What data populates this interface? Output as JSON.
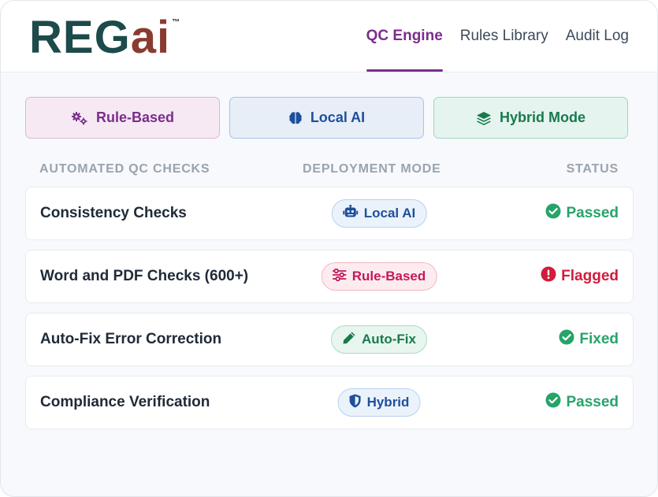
{
  "brand": {
    "logo_main": "REG",
    "logo_accent": "ai",
    "trademark": "™"
  },
  "nav": {
    "items": [
      {
        "label": "QC Engine",
        "active": true
      },
      {
        "label": "Rules Library",
        "active": false
      },
      {
        "label": "Audit Log",
        "active": false
      }
    ]
  },
  "modes": [
    {
      "label": "Rule-Based",
      "icon": "gears-icon"
    },
    {
      "label": "Local AI",
      "icon": "brain-icon"
    },
    {
      "label": "Hybrid Mode",
      "icon": "layers-icon"
    }
  ],
  "table": {
    "headers": {
      "check": "AUTOMATED QC CHECKS",
      "mode": "DEPLOYMENT MODE",
      "status": "STATUS"
    },
    "rows": [
      {
        "name": "Consistency Checks",
        "mode": "Local AI",
        "mode_icon": "robot-icon",
        "status": "Passed",
        "status_icon": "check-circle-icon"
      },
      {
        "name": "Word and PDF Checks (600+)",
        "mode": "Rule-Based",
        "mode_icon": "sliders-icon",
        "status": "Flagged",
        "status_icon": "exclamation-circle-icon"
      },
      {
        "name": "Auto-Fix Error Correction",
        "mode": "Auto-Fix",
        "mode_icon": "pencil-icon",
        "status": "Fixed",
        "status_icon": "check-circle-icon"
      },
      {
        "name": "Compliance Verification",
        "mode": "Hybrid",
        "mode_icon": "shield-icon",
        "status": "Passed",
        "status_icon": "check-circle-icon"
      }
    ]
  },
  "colors": {
    "brand_dark": "#1d4a4a",
    "brand_accent": "#8a3b30",
    "nav_active": "#7b2d8b",
    "passed": "#27a36a",
    "flagged": "#d11c3c"
  }
}
